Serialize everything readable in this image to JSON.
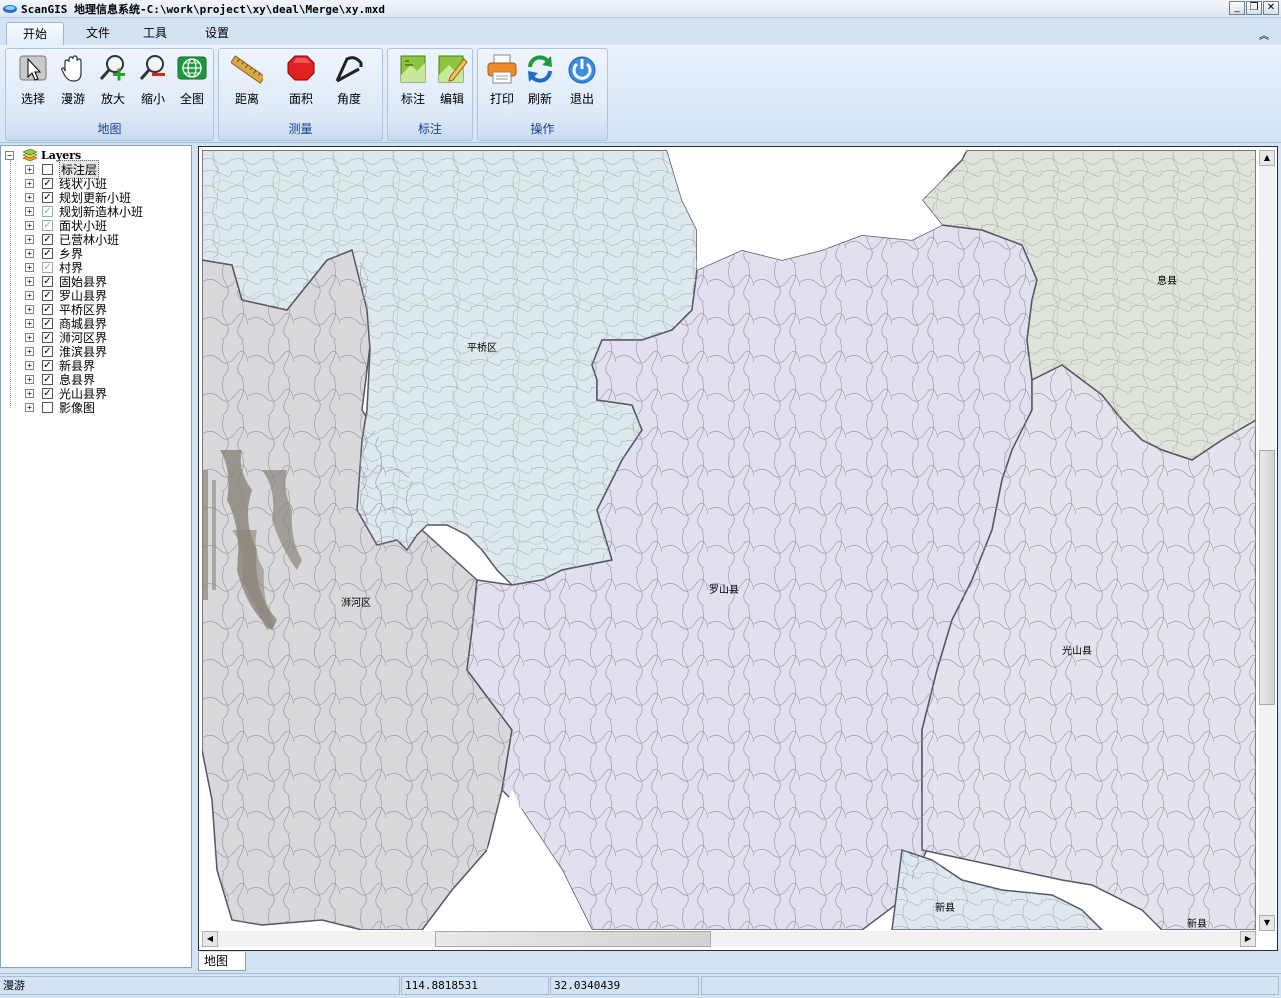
{
  "window": {
    "title": "ScanGIS 地理信息系统-C:\\work\\project\\xy\\deal\\Merge\\xy.mxd",
    "minimize": "_",
    "restore": "❐",
    "close": "✕"
  },
  "ribbon": {
    "tabs": [
      {
        "label": "开始",
        "active": true
      },
      {
        "label": "文件"
      },
      {
        "label": "工具"
      },
      {
        "label": "设置"
      }
    ],
    "collapse_symbol": "︽",
    "groups": {
      "map": {
        "label": "地图",
        "buttons": [
          {
            "label": "选择",
            "icon": "select-arrow-icon"
          },
          {
            "label": "漫游",
            "icon": "pan-hand-icon"
          },
          {
            "label": "放大",
            "icon": "zoom-in-icon"
          },
          {
            "label": "缩小",
            "icon": "zoom-out-icon"
          },
          {
            "label": "全图",
            "icon": "full-extent-globe-icon"
          }
        ]
      },
      "measure": {
        "label": "测量",
        "buttons": [
          {
            "label": "距离",
            "icon": "ruler-icon"
          },
          {
            "label": "面积",
            "icon": "area-octagon-icon"
          },
          {
            "label": "角度",
            "icon": "protractor-icon"
          }
        ]
      },
      "annotate": {
        "label": "标注",
        "buttons": [
          {
            "label": "标注",
            "icon": "annotate-map-icon"
          },
          {
            "label": "编辑",
            "icon": "edit-map-icon"
          }
        ]
      },
      "operate": {
        "label": "操作",
        "buttons": [
          {
            "label": "打印",
            "icon": "printer-icon"
          },
          {
            "label": "刷新",
            "icon": "refresh-icon"
          },
          {
            "label": "退出",
            "icon": "exit-power-icon"
          }
        ]
      }
    }
  },
  "layers": {
    "root": "Layers",
    "items": [
      {
        "name": "标注层",
        "check": " ",
        "selected": true
      },
      {
        "name": "线状小班",
        "check": "✓"
      },
      {
        "name": "规划更新小班",
        "check": "✓"
      },
      {
        "name": "规划新造林小班",
        "check": "✓",
        "grey": true
      },
      {
        "name": "面状小班",
        "check": "✓",
        "grey": true
      },
      {
        "name": "已营林小班",
        "check": "✓"
      },
      {
        "name": "乡界",
        "check": "✓"
      },
      {
        "name": "村界",
        "check": "✓",
        "grey": true
      },
      {
        "name": "固始县界",
        "check": "✓"
      },
      {
        "name": "罗山县界",
        "check": "✓"
      },
      {
        "name": "平桥区界",
        "check": "✓"
      },
      {
        "name": "商城县界",
        "check": "✓"
      },
      {
        "name": "浉河区界",
        "check": "✓"
      },
      {
        "name": "淮滨县界",
        "check": "✓"
      },
      {
        "name": "新县界",
        "check": "✓"
      },
      {
        "name": "息县界",
        "check": "✓"
      },
      {
        "name": "光山县界",
        "check": "✓"
      },
      {
        "name": "影像图",
        "check": " "
      }
    ]
  },
  "map": {
    "labels": [
      "平桥区",
      "息县",
      "浉河区",
      "罗山县",
      "光山县",
      "新县",
      "新县"
    ],
    "colors": {
      "pingqiao": "#dde9ec",
      "xixian": "#dee4d8",
      "shihe": "#d9d9dc",
      "luoshan": "#e0e0ef",
      "guangshan": "#e4e3ec",
      "xinxian": "#dfe8ee",
      "boundary": "#555566"
    },
    "tab_label": "地图"
  },
  "status": {
    "mode": "漫游",
    "x": "114.8818531",
    "y": "32.0340439"
  }
}
